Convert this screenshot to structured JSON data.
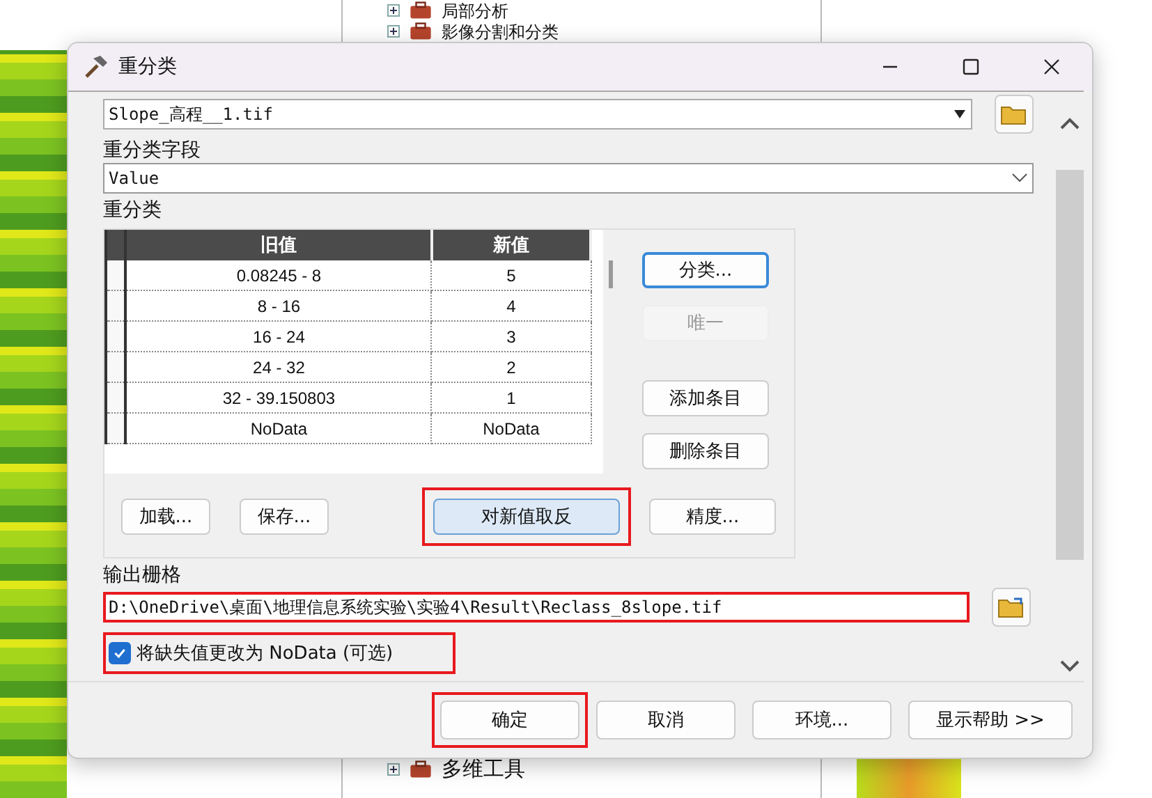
{
  "background_tree": {
    "top_items": [
      {
        "label": "局部分析"
      },
      {
        "label": "影像分割和分类"
      }
    ],
    "bottom_items": [
      {
        "label": "多维工具"
      }
    ]
  },
  "window": {
    "title": "重分类"
  },
  "input_raster": {
    "value": "Slope_高程__1.tif"
  },
  "reclass_field": {
    "label": "重分类字段",
    "value": "Value"
  },
  "reclass": {
    "label": "重分类",
    "table": {
      "columns": [
        "旧值",
        "新值"
      ],
      "rows": [
        {
          "old": "0.08245 - 8",
          "new": "5"
        },
        {
          "old": "8 - 16",
          "new": "4"
        },
        {
          "old": "16 - 24",
          "new": "3"
        },
        {
          "old": "24 - 32",
          "new": "2"
        },
        {
          "old": "32 - 39.150803",
          "new": "1"
        },
        {
          "old": "NoData",
          "new": "NoData"
        }
      ]
    },
    "side_buttons": [
      {
        "label": "分类...",
        "disabled": false,
        "focused": true
      },
      {
        "label": "唯一",
        "disabled": true,
        "focused": false
      },
      {
        "label": "添加条目",
        "disabled": false,
        "focused": false
      },
      {
        "label": "删除条目",
        "disabled": false,
        "focused": false
      }
    ],
    "bottom_buttons": [
      {
        "label": "加载...",
        "highlighted": false,
        "kind": "small"
      },
      {
        "label": "保存...",
        "highlighted": false,
        "kind": "small"
      },
      {
        "label": "对新值取反",
        "highlighted": true,
        "kind": "wide"
      },
      {
        "label": "精度...",
        "highlighted": false,
        "kind": "side"
      }
    ]
  },
  "output_raster": {
    "label": "输出栅格",
    "value": "D:\\OneDrive\\桌面\\地理信息系统实验\\实验4\\Result\\Reclass_8slope.tif",
    "highlighted": true
  },
  "nodata_option": {
    "label": "将缺失值更改为 NoData (可选)",
    "checked": true,
    "highlighted": true
  },
  "footer_buttons": [
    {
      "label": "确定",
      "highlighted": true
    },
    {
      "label": "取消",
      "highlighted": false
    },
    {
      "label": "环境...",
      "highlighted": false
    },
    {
      "label": "显示帮助 >>",
      "highlighted": false
    }
  ]
}
